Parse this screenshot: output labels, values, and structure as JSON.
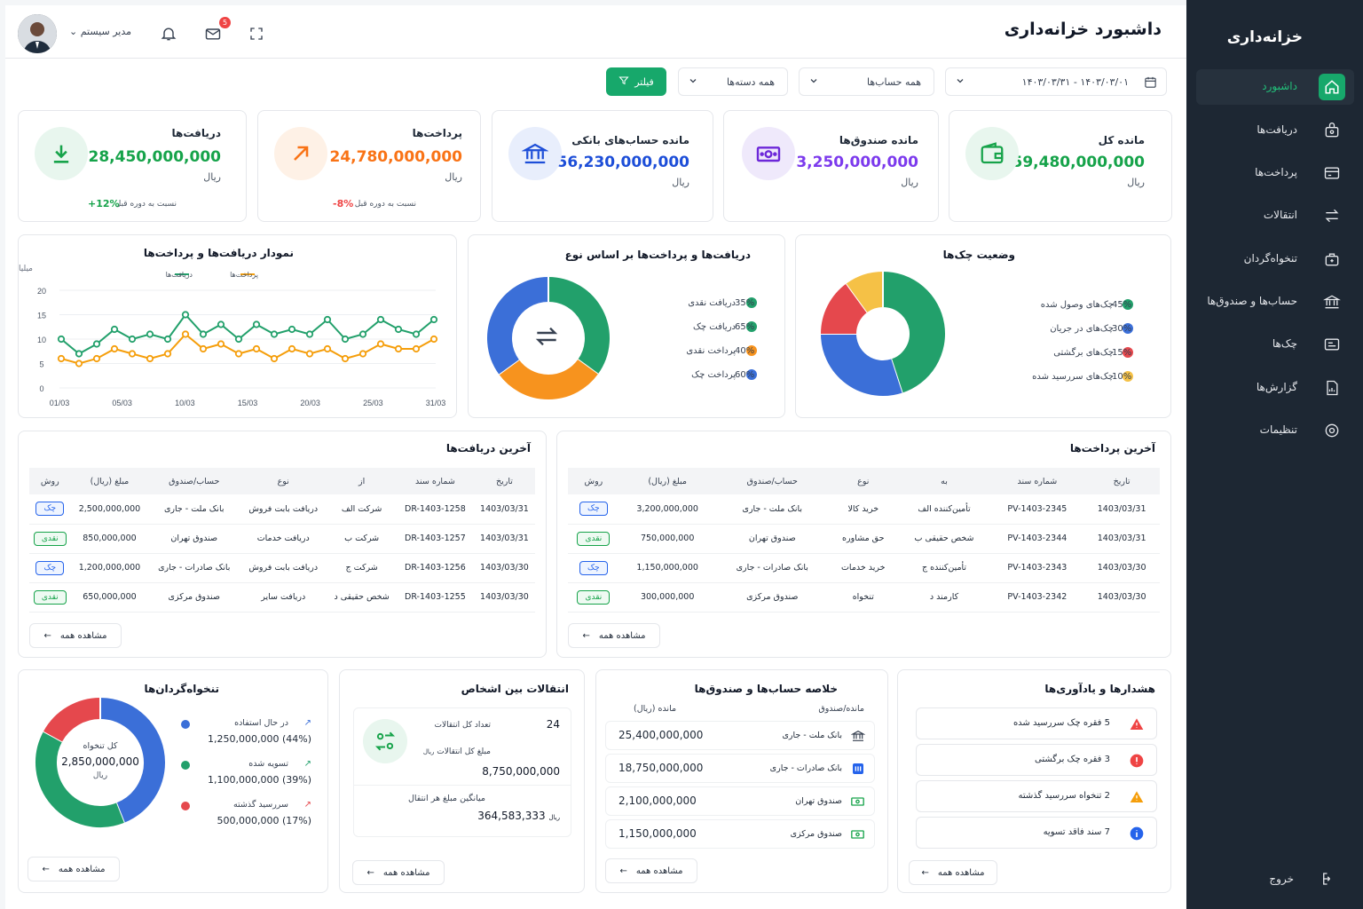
{
  "sidebar": {
    "title": "خزانه‌داری",
    "items": [
      {
        "label": "داشبورد",
        "icon": "home-icon"
      },
      {
        "label": "دریافت‌ها",
        "icon": "receive-icon"
      },
      {
        "label": "پرداخت‌ها",
        "icon": "payment-icon"
      },
      {
        "label": "انتقالات",
        "icon": "transfer-icon"
      },
      {
        "label": "تنخواه‌گردان",
        "icon": "petty-cash-icon"
      },
      {
        "label": "حساب‌ها و صندوق‌ها",
        "icon": "bank-icon"
      },
      {
        "label": "چک‌ها",
        "icon": "cheque-icon"
      },
      {
        "label": "گزارش‌ها",
        "icon": "report-icon"
      },
      {
        "label": "تنظیمات",
        "icon": "settings-icon"
      }
    ],
    "logout": "خروج"
  },
  "header": {
    "title": "داشبورد خزانه‌داری",
    "user": "مدیر سیستم",
    "mail_badge": "5"
  },
  "filters": {
    "date_range": "۱۴۰۳/۰۳/۰۱ - ۱۴۰۳/۰۳/۳۱",
    "account": "همه حساب‌ها",
    "type": "همه دسته‌ها",
    "filter_btn": "فیلتر"
  },
  "kpis": {
    "total": {
      "title": "مانده کل",
      "value": "59,480,000,000",
      "unit": "ریال",
      "color": "#16a34a"
    },
    "cash": {
      "title": "مانده صندوق‌ها",
      "value": "3,250,000,000",
      "unit": "ریال",
      "color": "#7c3aed"
    },
    "bank": {
      "title": "مانده حساب‌های بانکی",
      "value": "56,230,000,000",
      "unit": "ریال",
      "color": "#1d4ed8"
    },
    "payments": {
      "title": "پرداخت‌ها",
      "value": "24,780,000,000",
      "unit": "ریال",
      "cmp": "نسبت به دوره قبل",
      "pct": "-8%",
      "color": "#f97316"
    },
    "receipts": {
      "title": "دریافت‌ها",
      "value": "28,450,000,000",
      "unit": "ریال",
      "cmp": "نسبت به دوره قبل",
      "pct": "+12%",
      "color": "#16a34a"
    }
  },
  "line_chart": {
    "title": "نمودار دریافت‌ها و پرداخت‌ها",
    "unit": "میلیارد ریال",
    "legend_receive": "دریافت‌ها",
    "legend_pay": "پرداخت‌ها"
  },
  "type_chart": {
    "title": "دریافت‌ها و پرداخت‌ها بر اساس نوع",
    "items": [
      {
        "label": "دریافت نقدی",
        "pct": "35%"
      },
      {
        "label": "دریافت چک",
        "pct": "65%"
      },
      {
        "label": "پرداخت نقدی",
        "pct": "40%"
      },
      {
        "label": "پرداخت چک",
        "pct": "60%"
      }
    ]
  },
  "cheque_chart": {
    "title": "وضعیت چک‌ها",
    "items": [
      {
        "label": "چک‌های وصول شده",
        "pct": "45%"
      },
      {
        "label": "چک‌های در جریان",
        "pct": "30%"
      },
      {
        "label": "چک‌های برگشتی",
        "pct": "15%"
      },
      {
        "label": "چک‌های سررسید شده",
        "pct": "10%"
      }
    ]
  },
  "chart_data": [
    {
      "type": "line",
      "title": "نمودار دریافت‌ها و پرداخت‌ها",
      "ylabel": "میلیارد ریال",
      "ylim": [
        0,
        20
      ],
      "yticks": [
        "0",
        "5",
        "10",
        "15",
        "20"
      ],
      "xticks": [
        "01/03",
        "05/03",
        "10/03",
        "15/03",
        "20/03",
        "25/03",
        "31/03"
      ],
      "series": [
        {
          "name": "دریافت‌ها",
          "color": "#22a06b",
          "values": [
            10,
            7,
            9,
            12,
            10,
            11,
            10,
            15,
            11,
            13,
            10,
            13,
            11,
            12,
            11,
            14,
            10,
            11,
            14,
            12,
            11,
            14
          ]
        },
        {
          "name": "پرداخت‌ها",
          "color": "#f59e0b",
          "values": [
            6,
            5,
            6,
            8,
            7,
            6,
            7,
            11,
            8,
            9,
            7,
            8,
            6,
            8,
            7,
            8,
            6,
            7,
            9,
            8,
            8,
            10
          ]
        }
      ],
      "grid": true,
      "legend": "top"
    },
    {
      "type": "pie",
      "title": "دریافت‌ها و پرداخت‌ها بر اساس نوع",
      "slices": [
        {
          "label": "دریافت نقدی",
          "value": 35,
          "color": "#22a06b"
        },
        {
          "label": "پرداخت نقدی",
          "value": 30,
          "color": "#f7931e"
        },
        {
          "label": "پرداخت چک",
          "value": 35,
          "color": "#3b6fd8"
        }
      ]
    },
    {
      "type": "pie",
      "title": "وضعیت چک‌ها",
      "slices": [
        {
          "label": "چک‌های وصول شده",
          "value": 45,
          "color": "#22a06b"
        },
        {
          "label": "چک‌های در جریان",
          "value": 30,
          "color": "#3b6fd8"
        },
        {
          "label": "چک‌های برگشتی",
          "value": 15,
          "color": "#e5484d"
        },
        {
          "label": "چک‌های سررسید شده",
          "value": 10,
          "color": "#f5c146"
        }
      ]
    },
    {
      "type": "pie",
      "title": "تنخواه‌گردان‌ها",
      "slices": [
        {
          "label": "در حال استفاده",
          "value": 44,
          "color": "#3b6fd8"
        },
        {
          "label": "تسویه شده",
          "value": 39,
          "color": "#22a06b"
        },
        {
          "label": "سررسید گذشته",
          "value": 17,
          "color": "#e5484d"
        }
      ]
    }
  ],
  "receipts_table": {
    "title": "آخرین دریافت‌ها",
    "columns": [
      "تاریخ",
      "شماره سند",
      "از",
      "نوع",
      "حساب/صندوق",
      "مبلغ (ریال)",
      "روش"
    ],
    "rows": [
      [
        "1403/03/31",
        "DR-1403-1258",
        "شرکت الف",
        "دریافت بابت فروش",
        "بانک ملت - جاری",
        "2,500,000,000",
        "چک"
      ],
      [
        "1403/03/31",
        "DR-1403-1257",
        "شرکت ب",
        "دریافت خدمات",
        "صندوق تهران",
        "850,000,000",
        "نقدی"
      ],
      [
        "1403/03/30",
        "DR-1403-1256",
        "شرکت ج",
        "دریافت بابت فروش",
        "بانک صادرات - جاری",
        "1,200,000,000",
        "چک"
      ],
      [
        "1403/03/30",
        "DR-1403-1255",
        "شخص حقیقی د",
        "دریافت سایر",
        "صندوق مرکزی",
        "650,000,000",
        "نقدی"
      ]
    ],
    "see_all": "مشاهده همه"
  },
  "payments_table": {
    "title": "آخرین پرداخت‌ها",
    "columns": [
      "تاریخ",
      "شماره سند",
      "به",
      "نوع",
      "حساب/صندوق",
      "مبلغ (ریال)",
      "روش"
    ],
    "rows": [
      [
        "1403/03/31",
        "PV-1403-2345",
        "تأمین‌کننده الف",
        "خرید کالا",
        "بانک ملت - جاری",
        "3,200,000,000",
        "چک"
      ],
      [
        "1403/03/31",
        "PV-1403-2344",
        "شخص حقیقی ب",
        "حق مشاوره",
        "صندوق تهران",
        "750,000,000",
        "نقدی"
      ],
      [
        "1403/03/30",
        "PV-1403-2343",
        "تأمین‌کننده ج",
        "خرید خدمات",
        "بانک صادرات - جاری",
        "1,150,000,000",
        "چک"
      ],
      [
        "1403/03/30",
        "PV-1403-2342",
        "کارمند د",
        "تنخواه",
        "صندوق مرکزی",
        "300,000,000",
        "نقدی"
      ]
    ],
    "see_all": "مشاهده همه"
  },
  "petty": {
    "title": "تنخواه‌گردان‌ها",
    "center_label": "کل تنخواه",
    "center_value": "2,850,000,000",
    "center_unit": "ریال",
    "items": [
      {
        "label": "در حال استفاده",
        "value": "1,250,000,000 (44%)"
      },
      {
        "label": "تسویه شده",
        "value": "1,100,000,000 (39%)"
      },
      {
        "label": "سررسید گذشته",
        "value": "500,000,000 (17%)"
      }
    ],
    "see_all": "مشاهده همه"
  },
  "transfers": {
    "title": "انتقالات بین اشخاص",
    "count_label": "تعداد کل انتقالات",
    "count": "24",
    "sum_label": "مبلغ کل انتقالات",
    "sum_unit": "ریال",
    "sum": "8,750,000,000",
    "avg_label": "میانگین مبلغ هر انتقال",
    "avg": "364,583,333",
    "avg_unit": "ریال",
    "see_all": "مشاهده همه"
  },
  "accounts": {
    "title": "خلاصه حساب‌ها و صندوق‌ها",
    "col_name": "مانده/صندوق",
    "col_balance": "مانده (ریال)",
    "rows": [
      {
        "name": "بانک ملت - جاری",
        "value": "25,400,000,000",
        "icon": "bank-icon"
      },
      {
        "name": "بانک صادرات - جاری",
        "value": "18,750,000,000",
        "icon": "bank-card-icon"
      },
      {
        "name": "صندوق تهران",
        "value": "2,100,000,000",
        "icon": "cash-icon"
      },
      {
        "name": "صندوق مرکزی",
        "value": "1,150,000,000",
        "icon": "cash-icon"
      }
    ],
    "see_all": "مشاهده همه"
  },
  "alerts": {
    "title": "هشدارها و یادآوری‌ها",
    "items": [
      {
        "text": "5 فقره چک سررسید شده",
        "color": "#ef4444"
      },
      {
        "text": "3 فقره چک برگشتی",
        "color": "#ef4444"
      },
      {
        "text": "2 تنخواه سررسید گذشته",
        "color": "#f59e0b"
      },
      {
        "text": "7 سند فاقد تسویه",
        "color": "#2563eb"
      }
    ],
    "see_all": "مشاهده همه"
  }
}
